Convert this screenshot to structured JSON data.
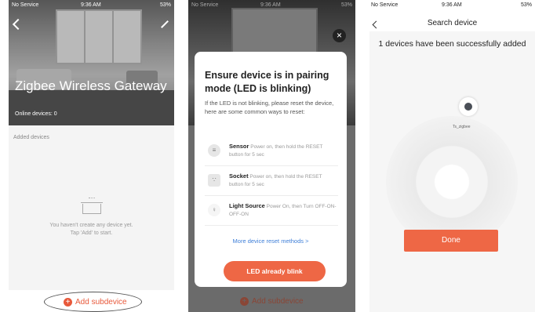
{
  "screen1": {
    "status": {
      "carrier": "No Service",
      "time": "9:36 AM",
      "battery": "53%"
    },
    "title": "Zigbee Wireless Gateway",
    "online_devices": "Online devices: 0",
    "added_devices_label": "Added devices",
    "empty_line1": "You haven't create any device yet.",
    "empty_line2": "Tap 'Add' to start.",
    "add_subdevice": "Add subdevice"
  },
  "screen2": {
    "status": {
      "carrier": "No Service",
      "time": "9:36 AM",
      "battery": "53%"
    },
    "dialog_title": "Ensure device is in pairing mode (LED is blinking)",
    "dialog_desc": "If the LED is not blinking, please reset the device, here are some common ways to reset:",
    "methods": [
      {
        "name": "Sensor",
        "desc": "Power on, then hold the RESET button for 5 sec",
        "icon": "sensor-icon"
      },
      {
        "name": "Socket",
        "desc": "Power on, then hold the RESET button for 5 sec",
        "icon": "socket-icon"
      },
      {
        "name": "Light Source",
        "desc": "Power On, then Turn OFF-ON-OFF-ON",
        "icon": "bulb-icon"
      }
    ],
    "more_methods": "More device reset methods >",
    "led_button": "LED already blink",
    "add_subdevice": "Add subdevice"
  },
  "screen3": {
    "status": {
      "carrier": "No Service",
      "time": "9:36 AM",
      "battery": "53%"
    },
    "title": "Search device",
    "status_text": "1 devices have been successfully added",
    "device_name": "Ts_zigbee",
    "done_button": "Done"
  },
  "colors": {
    "accent": "#ee6745",
    "link": "#3f7fd8"
  }
}
